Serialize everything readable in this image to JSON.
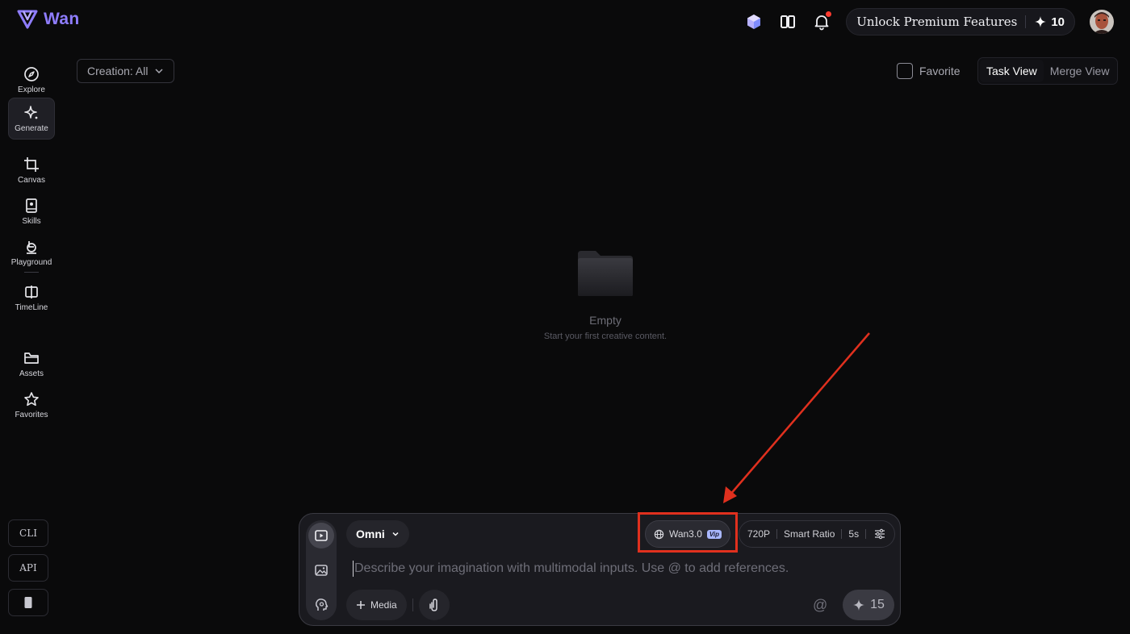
{
  "app": {
    "name": "Wan"
  },
  "header": {
    "premium_label": "Unlock Premium Features",
    "credits": "10"
  },
  "sidebar": {
    "items": [
      {
        "label": "Explore",
        "icon": "compass-icon"
      },
      {
        "label": "Generate",
        "icon": "sparkle-icon"
      },
      {
        "label": "Canvas",
        "icon": "crop-icon"
      },
      {
        "label": "Skills",
        "icon": "book-icon"
      },
      {
        "label": "Playground",
        "icon": "playground-icon"
      },
      {
        "label": "TimeLine",
        "icon": "timeline-icon"
      },
      {
        "label": "Assets",
        "icon": "folder-icon"
      },
      {
        "label": "Favorites",
        "icon": "star-icon"
      }
    ],
    "active": "Generate",
    "bottom": {
      "cli": "CLI",
      "api": "API"
    }
  },
  "filter": {
    "creation_label": "Creation: All"
  },
  "favorite": {
    "label": "Favorite"
  },
  "views": {
    "task": "Task View",
    "merge": "Merge View",
    "active": "Task View"
  },
  "empty": {
    "title": "Empty",
    "subtitle": "Start your first creative content."
  },
  "composer": {
    "mode": "Omni",
    "model": "Wan3.0",
    "model_badge": "Vip",
    "resolution": "720P",
    "ratio": "Smart Ratio",
    "duration": "5s",
    "placeholder": "Describe your imagination with multimodal inputs. Use @ to add references.",
    "media_label": "Media",
    "at_symbol": "@",
    "generate_cost": "15"
  },
  "colors": {
    "brand": "#8f7dff",
    "background": "#0a0a0b",
    "annotation": "#e0301e",
    "notification": "#ff3b30"
  }
}
